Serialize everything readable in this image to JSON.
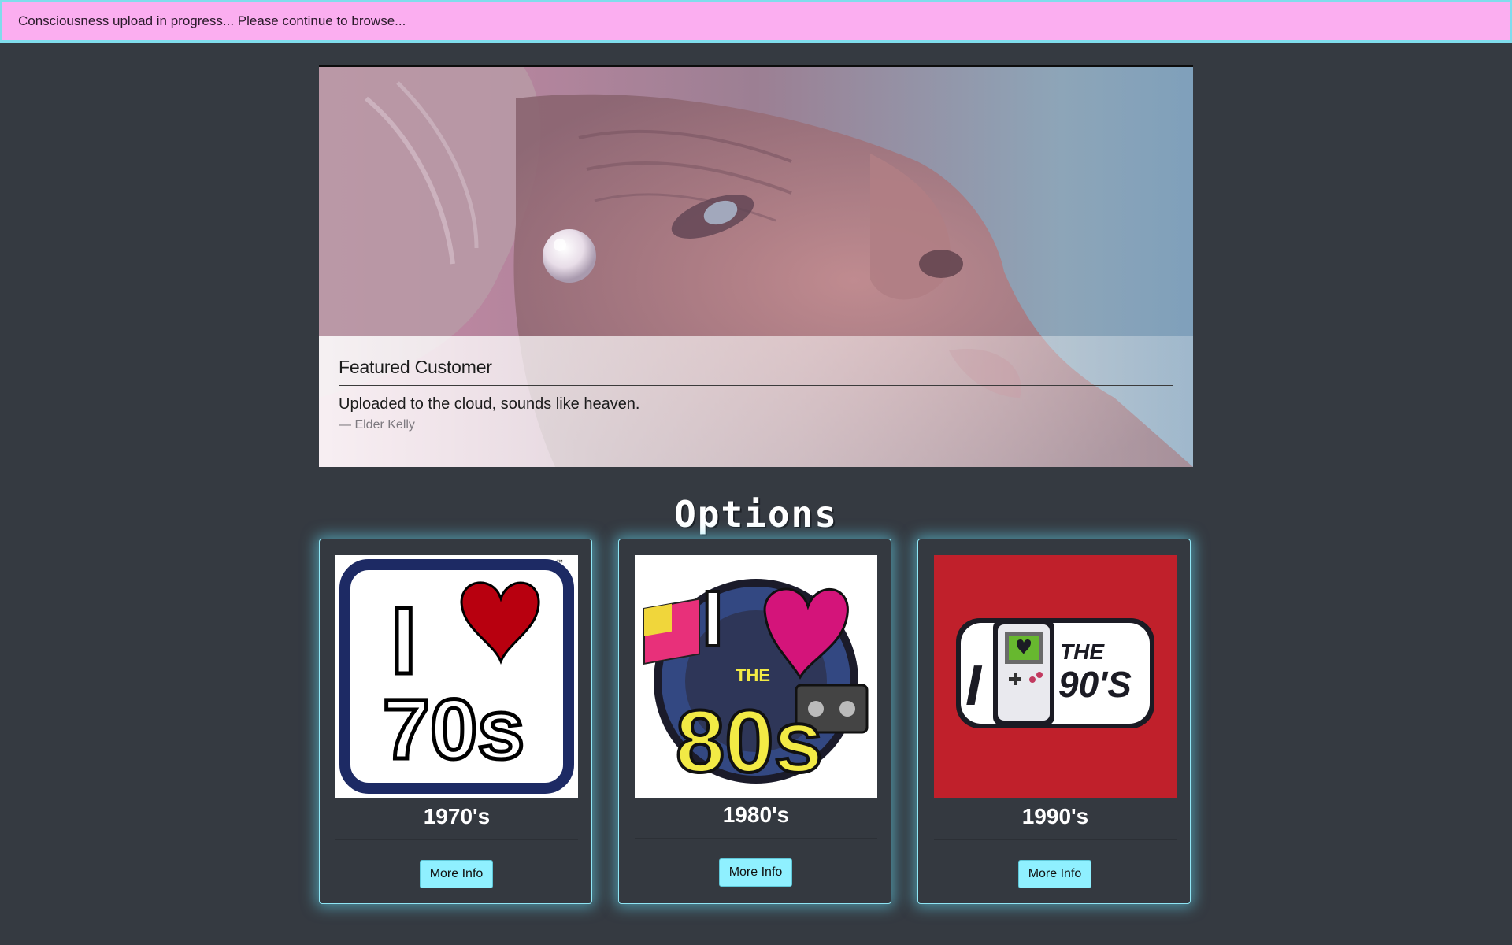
{
  "banner": {
    "text": "Consciousness upload in progress... Please continue to browse..."
  },
  "hero": {
    "title": "Featured Customer",
    "quote": "Uploaded to the cloud, sounds like heaven.",
    "author": "— Elder Kelly"
  },
  "options": {
    "heading": "Options",
    "cards": [
      {
        "title": "1970's",
        "button_label": "More Info",
        "image_text": [
          "I",
          "70s",
          "™"
        ]
      },
      {
        "title": "1980's",
        "button_label": "More Info",
        "image_text": [
          "I",
          "THE",
          "80s"
        ]
      },
      {
        "title": "1990's",
        "button_label": "More Info",
        "image_text": [
          "I",
          "THE",
          "90'S"
        ]
      }
    ]
  },
  "colors": {
    "page_bg": "#353a41",
    "banner_bg": "#fbaef0",
    "banner_border": "#7fdcec",
    "card_glow": "#8fe6f5",
    "button_bg": "#8ff0ff"
  }
}
